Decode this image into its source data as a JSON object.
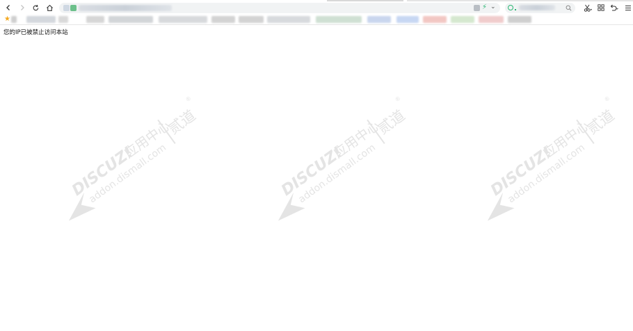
{
  "browser": {
    "nav": {
      "back_icon": "chevron-left-icon",
      "forward_icon": "chevron-right-icon",
      "reload_icon": "reload-icon",
      "home_icon": "home-icon"
    },
    "toolbar_icons": [
      "scissors-icon",
      "grid-icon",
      "undo-icon",
      "menu-icon"
    ]
  },
  "page": {
    "message": "您的IP已被禁止访问本站"
  },
  "watermark": {
    "brand": "DISCUZ!",
    "brand_cn": "应用中心",
    "site": "addon.dismall.com",
    "partner": "贰道",
    "mark": "®"
  },
  "colors": {
    "star": "#f4a81d",
    "watermark": "#e3e3e3"
  }
}
